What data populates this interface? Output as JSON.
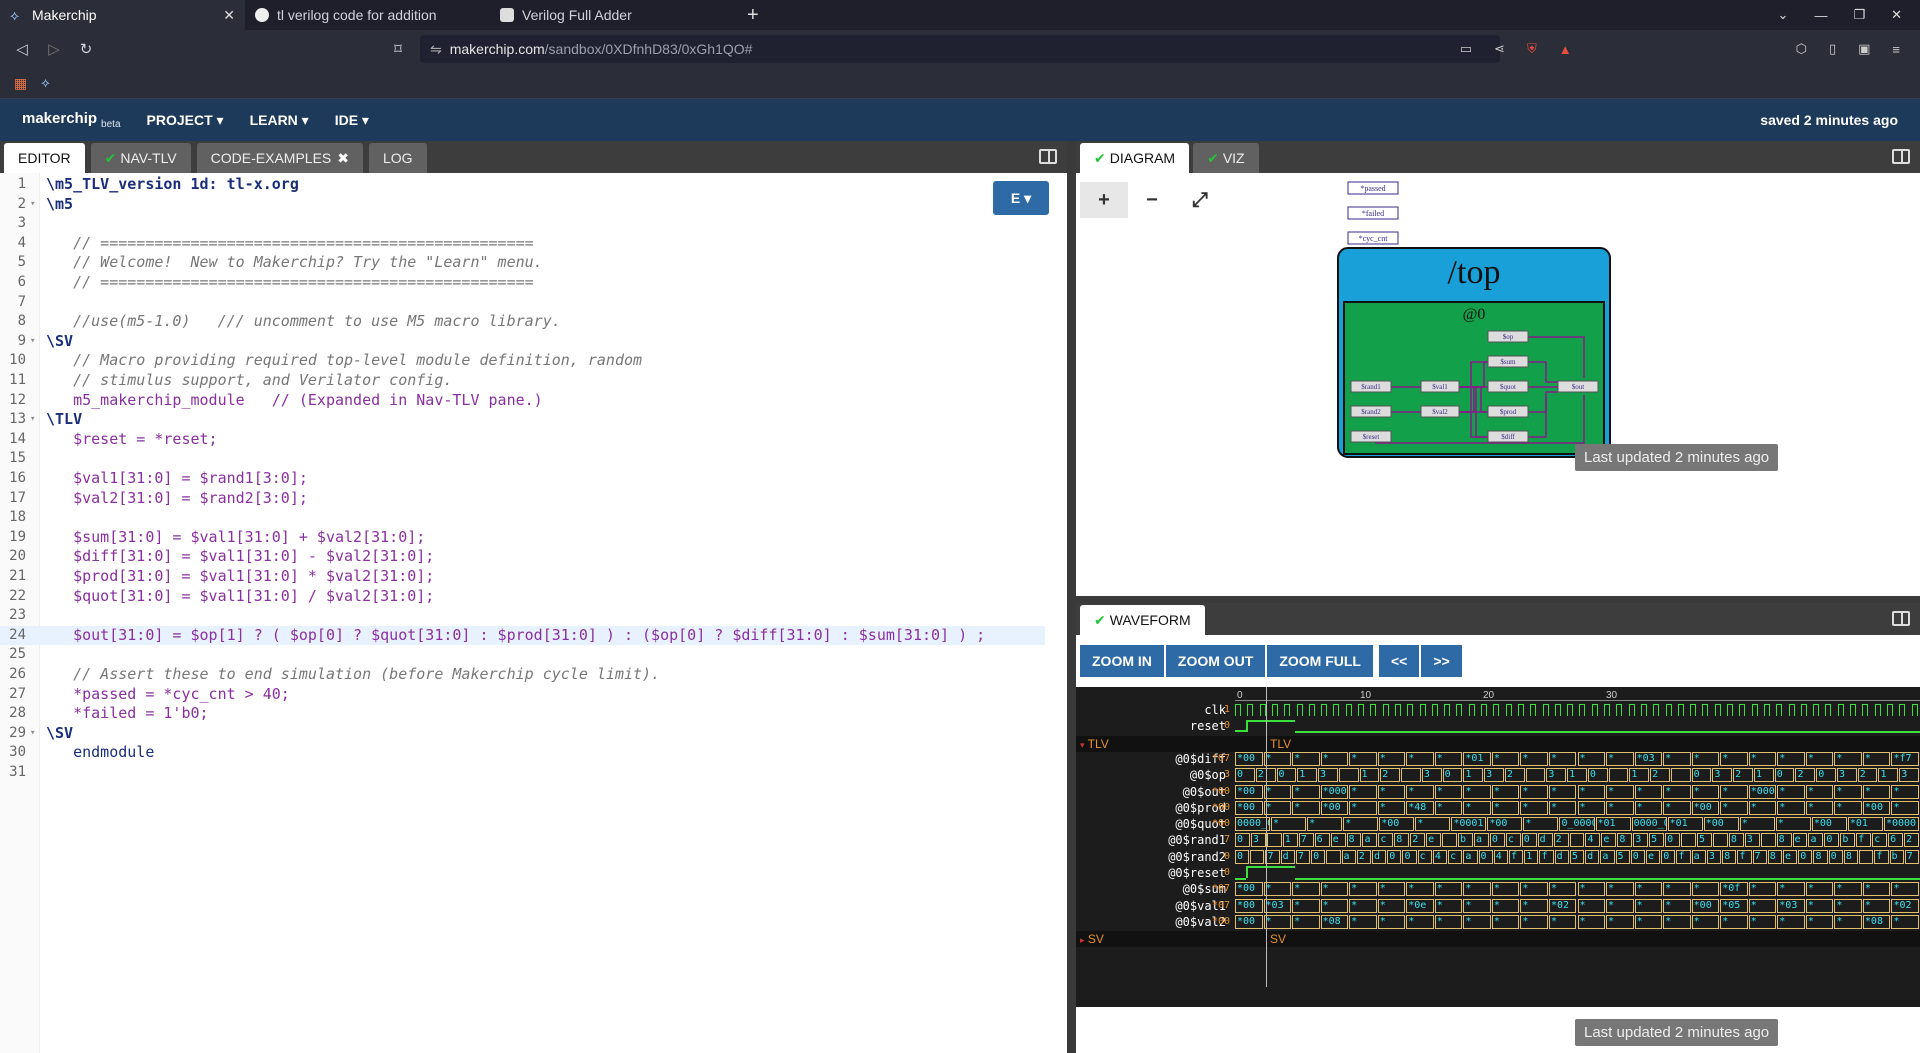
{
  "browser": {
    "tabs": [
      {
        "title": "Makerchip",
        "active": true
      },
      {
        "title": "tl verilog code for addition - G"
      },
      {
        "title": "Verilog Full Adder"
      }
    ],
    "new_tab": "+",
    "url_host": "makerchip.com",
    "url_path": "/sandbox/0XDfnhD83/0xGh1QO#"
  },
  "app": {
    "logo": "makerchip",
    "logo_sub": "beta",
    "menus": [
      "PROJECT ▾",
      "LEARN ▾",
      "IDE ▾"
    ],
    "saved": "saved 2 minutes ago"
  },
  "left_tabs": [
    "EDITOR",
    "NAV-TLV",
    "CODE-EXAMPLES",
    "LOG"
  ],
  "editor_button": "E ▾",
  "code": [
    "\\m5_TLV_version 1d: tl-x.org",
    "\\m5",
    "",
    "   // ================================================",
    "   // Welcome!  New to Makerchip? Try the \"Learn\" menu.",
    "   // ================================================",
    "",
    "   //use(m5-1.0)   /// uncomment to use M5 macro library.",
    "\\SV",
    "   // Macro providing required top-level module definition, random",
    "   // stimulus support, and Verilator config.",
    "   m5_makerchip_module   // (Expanded in Nav-TLV pane.)",
    "\\TLV",
    "   $reset = *reset;",
    "",
    "   $val1[31:0] = $rand1[3:0];",
    "   $val2[31:0] = $rand2[3:0];",
    "",
    "   $sum[31:0] = $val1[31:0] + $val2[31:0];",
    "   $diff[31:0] = $val1[31:0] - $val2[31:0];",
    "   $prod[31:0] = $val1[31:0] * $val2[31:0];",
    "   $quot[31:0] = $val1[31:0] / $val2[31:0];",
    "",
    "   $out[31:0] = $op[1] ? ( $op[0] ? $quot[31:0] : $prod[31:0] ) : ($op[0] ? $diff[31:0] : $sum[31:0] ) ;",
    "",
    "   // Assert these to end simulation (before Makerchip cycle limit).",
    "   *passed = *cyc_cnt > 40;",
    "   *failed = 1'b0;",
    "\\SV",
    "   endmodule",
    ""
  ],
  "right_tabs": [
    "DIAGRAM",
    "VIZ"
  ],
  "diagram": {
    "tools": [
      "+",
      "−",
      "⤢"
    ],
    "signals": [
      "*passed",
      "*failed",
      "*cyc_cnt"
    ],
    "scope": "/top",
    "stage": "@0",
    "nodes": [
      "$op",
      "$sum",
      "$rand1",
      "$val1",
      "$quot",
      "$out",
      "$rand2",
      "$val2",
      "$prod",
      "$reset",
      "$diff"
    ],
    "last_updated": "Last updated 2 minutes ago"
  },
  "waveform": {
    "tab": "WAVEFORM",
    "buttons": [
      "ZOOM IN",
      "ZOOM OUT",
      "ZOOM FULL"
    ],
    "nav": [
      "<<",
      ">>"
    ],
    "ticks": [
      "0",
      "10",
      "20",
      "30"
    ],
    "top_signals": [
      {
        "name": "clk",
        "val": "1"
      },
      {
        "name": "reset",
        "val": "0"
      }
    ],
    "tlv_section": "TLV",
    "signals": [
      {
        "name": "@0$diff",
        "val": "*07",
        "cells": [
          "*00",
          "*",
          "*",
          "*",
          "*",
          "*",
          "*",
          "*",
          "*01",
          "*",
          "*",
          "*",
          "*",
          "*",
          "*03",
          "*",
          "*",
          "*",
          "*",
          "*",
          "*",
          "*",
          "*",
          "*f7"
        ]
      },
      {
        "name": "@0$op",
        "val": "3",
        "cells": [
          "0",
          "2",
          "0",
          "1",
          "3",
          "",
          "1",
          "2",
          "",
          "3",
          "0",
          "1",
          "3",
          "2",
          "",
          "3",
          "1",
          "0",
          "",
          "1",
          "2",
          "",
          "0",
          "3",
          "2",
          "1",
          "0",
          "2",
          "0",
          "3",
          "2",
          "1",
          "3"
        ]
      },
      {
        "name": "@0$out",
        "val": "*00",
        "cells": [
          "*00",
          "*",
          "*",
          "*0000",
          "*",
          "*",
          "*",
          "*",
          "*",
          "*",
          "*",
          "*",
          "*",
          "*",
          "*",
          "*",
          "*",
          "*",
          "*0000",
          "*",
          "*",
          "*",
          "*",
          "*"
        ]
      },
      {
        "name": "@0$prod",
        "val": "*00",
        "cells": [
          "*00",
          "*",
          "*",
          "*00",
          "*",
          "*",
          "*48",
          "*",
          "*",
          "*",
          "*",
          "*",
          "*",
          "*",
          "*",
          "*",
          "*00",
          "*",
          "*",
          "*",
          "*",
          "*",
          "*00",
          "*"
        ]
      },
      {
        "name": "@0$quot",
        "val": "*00",
        "cells": [
          "0000_0000",
          "*",
          "*",
          "*",
          "*00",
          "*",
          "*0001",
          "*00",
          "*",
          "0_0000",
          "*01",
          "0000_0000",
          "*01",
          "*00",
          "*",
          "*",
          "*00",
          "*01",
          "*0000"
        ]
      },
      {
        "name": "@0$rand1",
        "val": "7",
        "cells": [
          "0",
          "3",
          "",
          "1",
          "7",
          "6",
          "e",
          "8",
          "a",
          "c",
          "8",
          "2",
          "e",
          "",
          "b",
          "a",
          "0",
          "c",
          "0",
          "d",
          "2",
          "",
          "4",
          "e",
          "8",
          "3",
          "5",
          "0",
          "",
          "5",
          "",
          "8",
          "3",
          "",
          "8",
          "e",
          "a",
          "0",
          "b",
          "f",
          "c",
          "6",
          "2"
        ]
      },
      {
        "name": "@0$rand2",
        "val": "0",
        "cells": [
          "0",
          "",
          "7",
          "d",
          "7",
          "0",
          "",
          "a",
          "2",
          "d",
          "0",
          "0",
          "c",
          "4",
          "c",
          "a",
          "0",
          "4",
          "f",
          "1",
          "f",
          "d",
          "5",
          "d",
          "a",
          "5",
          "0",
          "e",
          "0",
          "f",
          "a",
          "3",
          "8",
          "f",
          "7",
          "8",
          "e",
          "0",
          "8",
          "0",
          "8",
          "",
          "f",
          "b",
          "7"
        ]
      },
      {
        "name": "@0$reset",
        "val": "0",
        "cells": []
      },
      {
        "name": "@0$sum",
        "val": "*07",
        "cells": [
          "*00",
          "*",
          "*",
          "*",
          "*",
          "*",
          "*",
          "*",
          "*",
          "*",
          "*",
          "*",
          "*",
          "*",
          "*",
          "*",
          "*",
          "*0f",
          "*",
          "*",
          "*",
          "*",
          "*",
          "*"
        ]
      },
      {
        "name": "@0$val1",
        "val": "*07",
        "cells": [
          "*00",
          "*03",
          "*",
          "*",
          "*",
          "*",
          "*0e",
          "*",
          "*",
          "*",
          "*",
          "*02",
          "*",
          "*",
          "*",
          "*",
          "*00",
          "*05",
          "*",
          "*03",
          "*",
          "*",
          "*",
          "*02"
        ]
      },
      {
        "name": "@0$val2",
        "val": "*00",
        "cells": [
          "*00",
          "*",
          "*",
          "*08",
          "*",
          "*",
          "*",
          "*",
          "*",
          "*",
          "*",
          "*",
          "*",
          "*",
          "*",
          "*",
          "*",
          "*",
          "*",
          "*",
          "*",
          "*",
          "*08",
          "*"
        ]
      }
    ],
    "sv_section": "SV",
    "last_updated": "Last updated 2 minutes ago"
  }
}
